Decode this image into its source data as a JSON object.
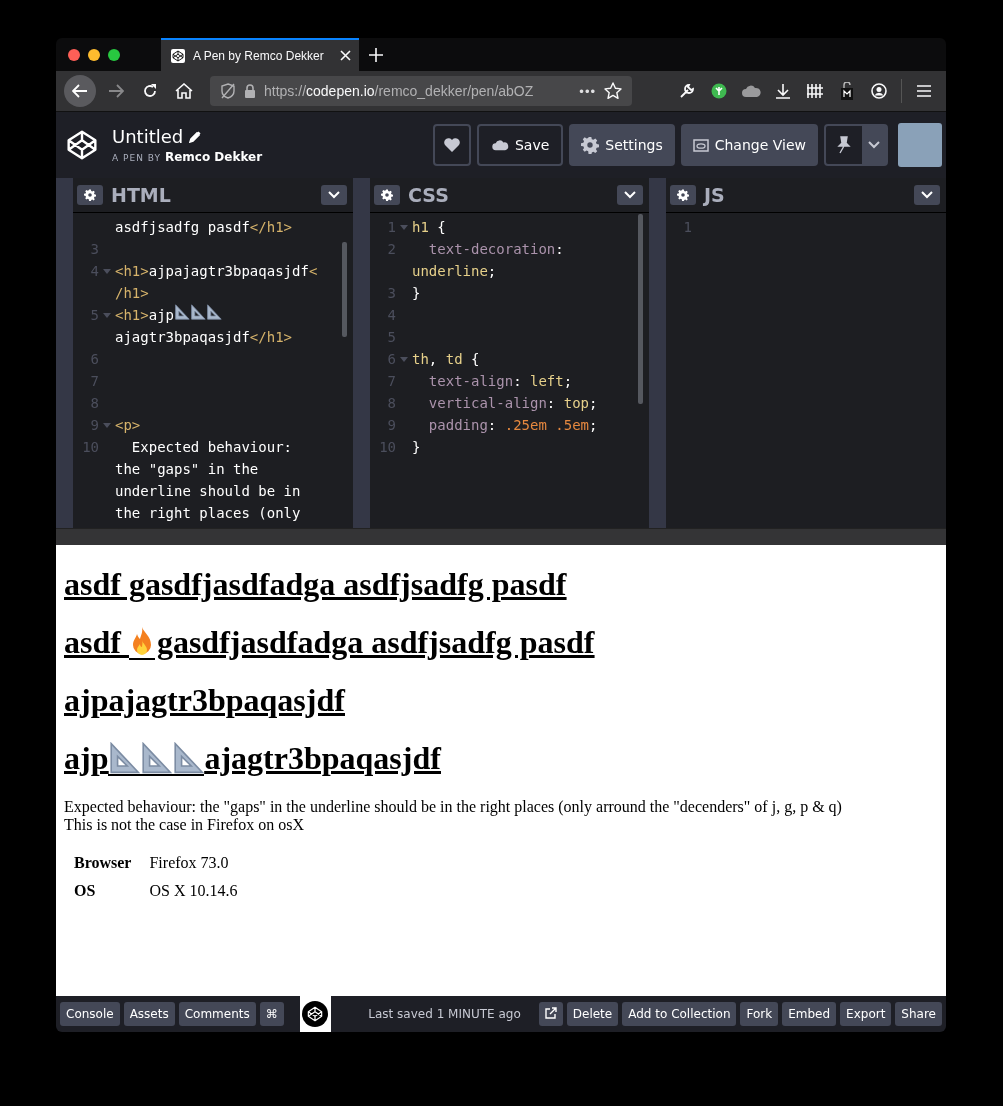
{
  "browser": {
    "tab": {
      "title": "A Pen by Remco Dekker"
    },
    "url": "https://**codepen.io**/remco_dekker/pen/abOZ",
    "url_more": "•••"
  },
  "header": {
    "title": "Untitled",
    "byline_prefix": "A PEN BY",
    "author": "Remco Dekker",
    "buttons": [
      {
        "kind": "heart"
      },
      {
        "kind": "cloud",
        "label": "Save"
      },
      {
        "kind": "gear",
        "label": "Settings"
      },
      {
        "kind": "view",
        "label": "Change View"
      },
      {
        "kind": "pin"
      }
    ]
  },
  "editors": [
    {
      "title": "HTML",
      "lines": [
        {
          "tokens": [
            {
              "kind": "text",
              "text": "asdfjsadfg pasdf"
            },
            {
              "kind": "tag",
              "text": "</h1>"
            }
          ]
        },
        {
          "number": "3"
        },
        {
          "number": "4",
          "fold": true,
          "tokens": [
            {
              "kind": "tag",
              "text": "<h1>"
            },
            {
              "kind": "text",
              "text": "ajpajagtr3bpaqasjdf"
            },
            {
              "kind": "tag",
              "text": "<"
            }
          ]
        },
        {
          "tokens": [
            {
              "kind": "tag",
              "text": "/h1>"
            }
          ]
        },
        {
          "number": "5",
          "fold": true,
          "tokens": [
            {
              "kind": "tag",
              "text": "<h1>"
            },
            {
              "kind": "text",
              "text": "ajp"
            },
            {
              "kind": "ruler"
            },
            {
              "kind": "ruler"
            },
            {
              "kind": "ruler"
            }
          ]
        },
        {
          "tokens": [
            {
              "kind": "text",
              "text": "ajagtr3bpaqasjdf"
            },
            {
              "kind": "tag",
              "text": "</h1>"
            }
          ]
        },
        {
          "number": "6"
        },
        {
          "number": "7"
        },
        {
          "number": "8"
        },
        {
          "number": "9",
          "fold": true,
          "tokens": [
            {
              "kind": "tag",
              "text": "<p>"
            }
          ]
        },
        {
          "number": "10",
          "tokens": [
            {
              "kind": "text",
              "text": "  Expected behaviour:"
            }
          ]
        },
        {
          "tokens": [
            {
              "kind": "text",
              "text": "the \"gaps\" in the"
            }
          ]
        },
        {
          "tokens": [
            {
              "kind": "text",
              "text": "underline should be in"
            }
          ]
        },
        {
          "tokens": [
            {
              "kind": "text",
              "text": "the right places (only"
            }
          ]
        }
      ]
    },
    {
      "title": "CSS",
      "lines": [
        {
          "number": "1",
          "fold": true,
          "tokens": [
            {
              "kind": "selector",
              "text": "h1"
            },
            {
              "kind": "text",
              "text": " {"
            }
          ]
        },
        {
          "number": "2",
          "tokens": [
            {
              "kind": "property",
              "text": "  text-decoration"
            },
            {
              "kind": "text",
              "text": ":"
            }
          ]
        },
        {
          "tokens": [
            {
              "kind": "value",
              "text": "underline"
            },
            {
              "kind": "text",
              "text": ";"
            }
          ]
        },
        {
          "number": "3",
          "tokens": [
            {
              "kind": "text",
              "text": "}"
            }
          ]
        },
        {
          "number": "4"
        },
        {
          "number": "5"
        },
        {
          "number": "6",
          "fold": true,
          "tokens": [
            {
              "kind": "selector",
              "text": "th"
            },
            {
              "kind": "text",
              "text": ", "
            },
            {
              "kind": "selector",
              "text": "td"
            },
            {
              "kind": "text",
              "text": " {"
            }
          ]
        },
        {
          "number": "7",
          "tokens": [
            {
              "kind": "property",
              "text": "  text-align"
            },
            {
              "kind": "text",
              "text": ": "
            },
            {
              "kind": "value",
              "text": "left"
            },
            {
              "kind": "text",
              "text": ";"
            }
          ]
        },
        {
          "number": "8",
          "tokens": [
            {
              "kind": "property",
              "text": "  vertical-align"
            },
            {
              "kind": "text",
              "text": ": "
            },
            {
              "kind": "value",
              "text": "top"
            },
            {
              "kind": "text",
              "text": ";"
            }
          ]
        },
        {
          "number": "9",
          "tokens": [
            {
              "kind": "property",
              "text": "  padding"
            },
            {
              "kind": "text",
              "text": ": "
            },
            {
              "kind": "number",
              "text": ".25em .5em"
            },
            {
              "kind": "text",
              "text": ";"
            }
          ]
        },
        {
          "number": "10",
          "tokens": [
            {
              "kind": "text",
              "text": "}"
            }
          ]
        }
      ]
    },
    {
      "title": "JS",
      "lines": [
        {
          "number": "1"
        }
      ]
    }
  ],
  "preview": {
    "headings": [
      {
        "parts": [
          {
            "kind": "text",
            "text": "asdf gasdfjasdfadga asdfjsadfg pasdf"
          }
        ]
      },
      {
        "parts": [
          {
            "kind": "text",
            "text": "asdf "
          },
          {
            "kind": "fire"
          },
          {
            "kind": "text",
            "text": "gasdfjasdfadga asdfjsadfg pasdf"
          }
        ]
      },
      {
        "parts": [
          {
            "kind": "text",
            "text": "ajpajagtr3bpaqasjdf"
          }
        ]
      },
      {
        "parts": [
          {
            "kind": "text",
            "text": "ajp"
          },
          {
            "kind": "ruler"
          },
          {
            "kind": "ruler"
          },
          {
            "kind": "ruler"
          },
          {
            "kind": "text",
            "text": "ajagtr3bpaqasjdf"
          }
        ]
      }
    ],
    "paragraph_lines": [
      "Expected behaviour: the \"gaps\" in the underline should be in the right places (only arround the \"decenders\" of j, g, p & q)",
      "This is not the case in Firefox on osX"
    ],
    "table": [
      {
        "header": "Browser",
        "value": "Firefox 73.0"
      },
      {
        "header": "OS",
        "value": "OS X 10.14.6"
      }
    ]
  },
  "footer": {
    "left_buttons": [
      "Console",
      "Assets",
      "Comments",
      "⌘"
    ],
    "status": "Last saved 1 MINUTE ago",
    "right_buttons": [
      "Delete",
      "Add to Collection",
      "Fork",
      "Embed",
      "Export",
      "Share"
    ]
  }
}
